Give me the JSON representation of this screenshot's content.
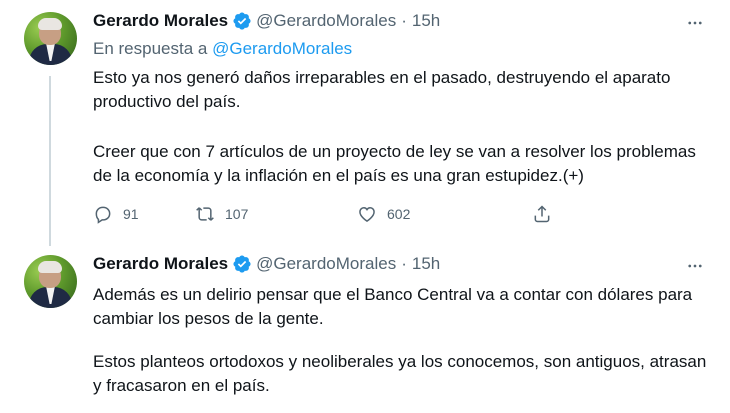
{
  "tweets": [
    {
      "author_name": "Gerardo Morales",
      "handle": "@GerardoMorales",
      "separator": "·",
      "time": "15h",
      "reply_prefix": "En respuesta a",
      "reply_to": "@GerardoMorales",
      "paragraphs": [
        "Esto ya nos generó daños irreparables en el pasado, destruyendo el aparato productivo del país.",
        "Creer que con 7 artículos de un proyecto de ley se van a resolver los problemas de la economía y la inflación en el país es una gran estupidez.(+)"
      ],
      "actions": {
        "replies": "91",
        "retweets": "107",
        "likes": "602"
      }
    },
    {
      "author_name": "Gerardo Morales",
      "handle": "@GerardoMorales",
      "separator": "·",
      "time": "15h",
      "paragraphs": [
        "Además es un delirio pensar que el Banco Central va a contar con dólares para cambiar los pesos de la gente.",
        "Estos planteos ortodoxos y neoliberales ya los conocemos, son antiguos, atrasan y fracasaron en el país."
      ]
    }
  ],
  "icons": {
    "verified": "verified-badge-icon",
    "more": "more-dots-icon",
    "reply": "reply-icon",
    "retweet": "retweet-icon",
    "like": "heart-icon",
    "share": "share-icon"
  },
  "colors": {
    "accent": "#1d9bf0",
    "text": "#0f1419",
    "muted": "#536471",
    "thread_line": "#cfd9de"
  }
}
